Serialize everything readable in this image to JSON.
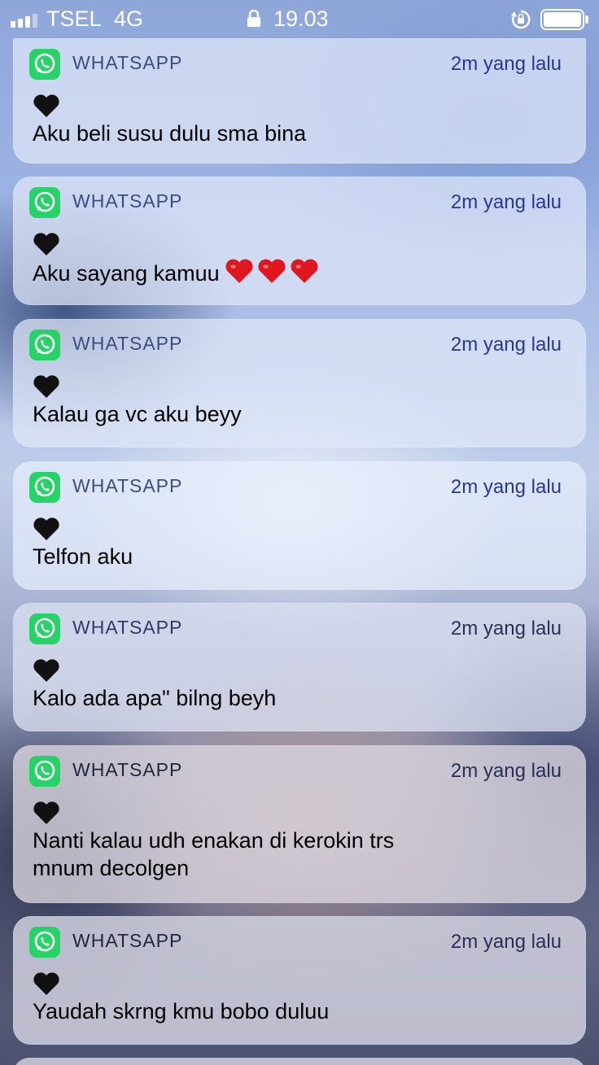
{
  "status_bar": {
    "carrier": "TSEL",
    "network": "4G",
    "time": "19.03",
    "icons": [
      "signal-icon",
      "lock-icon",
      "rotation-lock-icon",
      "battery-icon"
    ]
  },
  "notifications": [
    {
      "app": "WHATSAPP",
      "time_ago": "2m yang lalu",
      "sender_icon": "black-heart-icon",
      "message": "Aku beli susu dulu sma bina"
    },
    {
      "app": "WHATSAPP",
      "time_ago": "2m yang lalu",
      "sender_icon": "black-heart-icon",
      "message": "Aku sayang kamuu",
      "message_emoji": "red-heart-icon x3"
    },
    {
      "app": "WHATSAPP",
      "time_ago": "2m yang lalu",
      "sender_icon": "black-heart-icon",
      "message": "Kalau ga vc aku beyy"
    },
    {
      "app": "WHATSAPP",
      "time_ago": "2m yang lalu",
      "sender_icon": "black-heart-icon",
      "message": "Telfon aku"
    },
    {
      "app": "WHATSAPP",
      "time_ago": "2m yang lalu",
      "sender_icon": "black-heart-icon",
      "message": "Kalo ada apa\" bilng beyh"
    },
    {
      "app": "WHATSAPP",
      "time_ago": "2m yang lalu",
      "sender_icon": "black-heart-icon",
      "message": "Nanti kalau udh enakan di kerokin trs mnum decolgen"
    },
    {
      "app": "WHATSAPP",
      "time_ago": "2m yang lalu",
      "sender_icon": "black-heart-icon",
      "message": "Yaudah skrng kmu bobo duluu"
    }
  ],
  "colors": {
    "whatsapp_green": "#25D366",
    "heart_red": "#e0171f",
    "black_heart": "#111111"
  }
}
